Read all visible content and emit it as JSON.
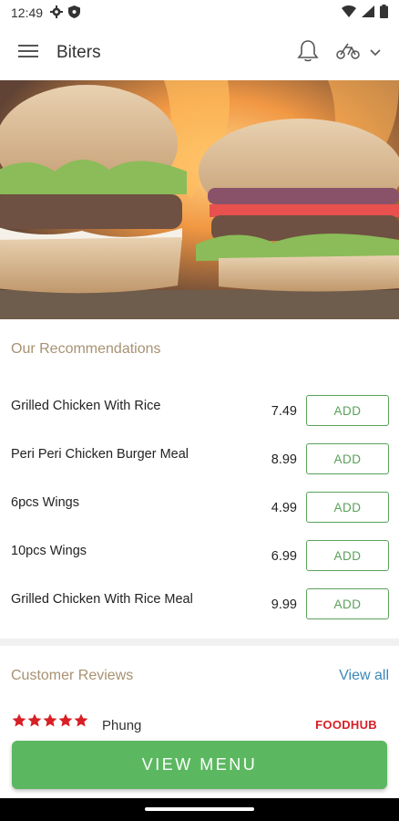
{
  "status": {
    "time": "12:49",
    "left_icons": [
      "gear-icon",
      "shield-icon"
    ],
    "right_icons": [
      "wifi-icon",
      "signal-icon",
      "battery-icon"
    ]
  },
  "app_bar": {
    "title": "Biters",
    "menu_icon": "hamburger-icon",
    "bell_icon": "bell-icon",
    "delivery_icon": "delivery-icon",
    "dropdown_icon": "chevron-down-icon"
  },
  "hero": {
    "image": "burgers-on-fire"
  },
  "recommendations": {
    "title": "Our Recommendations",
    "items": [
      {
        "name": "Grilled Chicken With Rice",
        "price": "7.49",
        "button": "ADD"
      },
      {
        "name": "Peri Peri Chicken Burger Meal",
        "price": "8.99",
        "button": "ADD"
      },
      {
        "name": "6pcs Wings",
        "price": "4.99",
        "button": "ADD"
      },
      {
        "name": "10pcs Wings",
        "price": "6.99",
        "button": "ADD"
      },
      {
        "name": "Grilled Chicken With Rice Meal",
        "price": "9.99",
        "button": "ADD"
      }
    ]
  },
  "reviews": {
    "title": "Customer Reviews",
    "view_all": "View all",
    "items": [
      {
        "rating": 5,
        "reviewer": "Phung",
        "source": "FOODHUB"
      }
    ]
  },
  "cta": {
    "label": "VIEW MENU"
  },
  "colors": {
    "accent_green": "#5cb860",
    "section_title": "#a89272",
    "link_blue": "#3b87b8",
    "star_red": "#d81f26"
  }
}
